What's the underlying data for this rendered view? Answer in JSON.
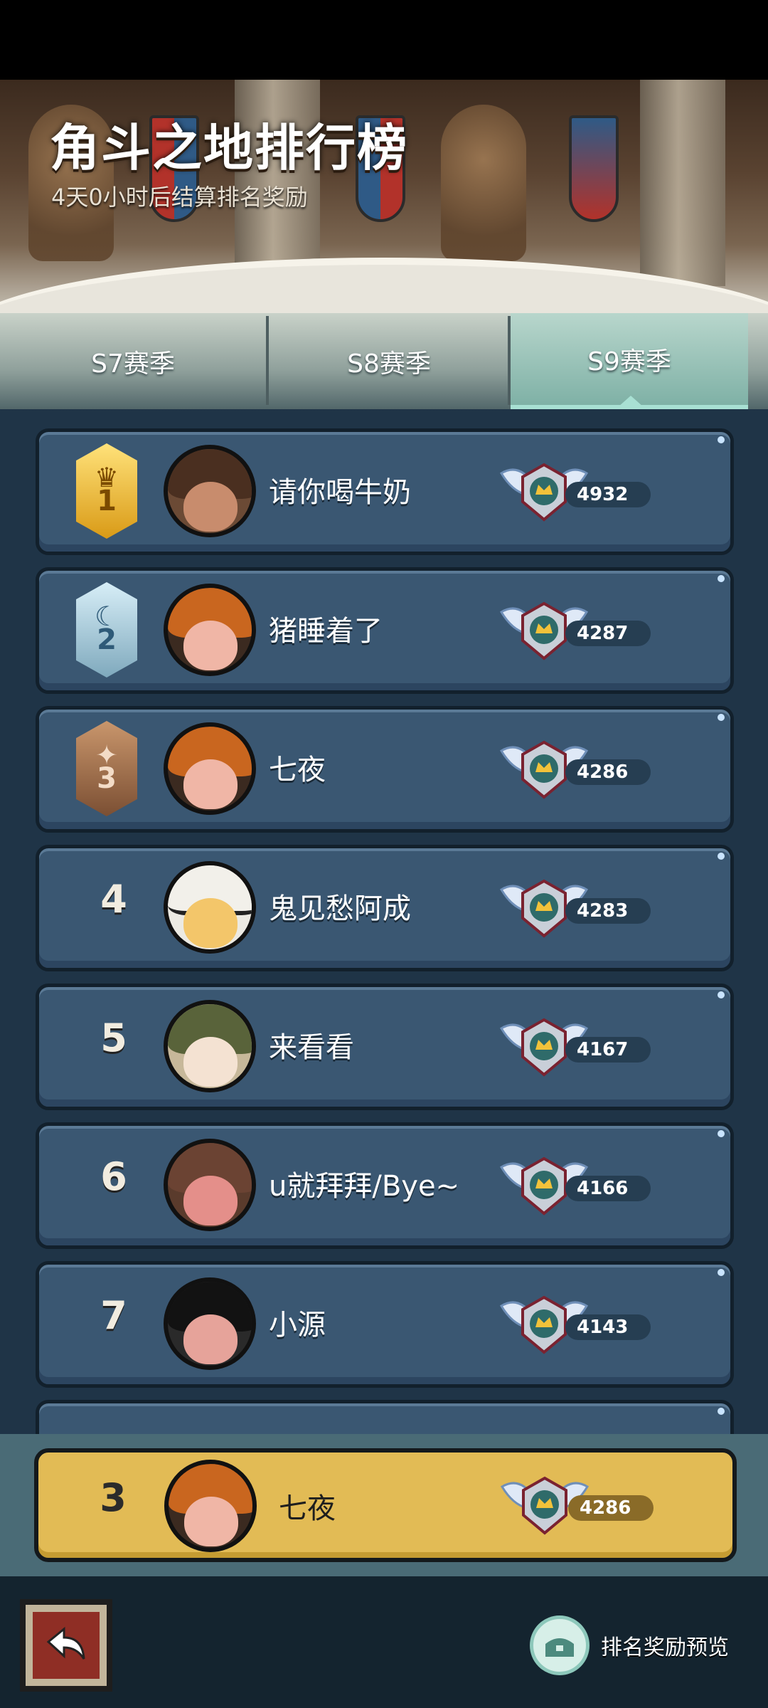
{
  "banner": {
    "title": "角斗之地排行榜",
    "subtitle": "4天0小时后结算排名奖励"
  },
  "tabs": [
    {
      "label": "S7赛季",
      "active": false
    },
    {
      "label": "S8赛季",
      "active": false
    },
    {
      "label": "S9赛季",
      "active": true
    }
  ],
  "leaderboard": [
    {
      "rank": "1",
      "medal": "gold",
      "name": "请你喝牛奶",
      "score": "4932",
      "avatar": "cowboy-hat-avatar"
    },
    {
      "rank": "2",
      "medal": "silver",
      "name": "猪睡着了",
      "score": "4287",
      "avatar": "pumpkin-hat-avatar"
    },
    {
      "rank": "3",
      "medal": "bronze",
      "name": "七夜",
      "score": "4286",
      "avatar": "pumpkin-hat-avatar"
    },
    {
      "rank": "4",
      "medal": "",
      "name": "鬼见愁阿成",
      "score": "4283",
      "avatar": "panda-hood-avatar"
    },
    {
      "rank": "5",
      "medal": "",
      "name": "来看看",
      "score": "4167",
      "avatar": "frog-hat-avatar"
    },
    {
      "rank": "6",
      "medal": "",
      "name": "u就拜拜/Bye~",
      "score": "4166",
      "avatar": "bear-hood-avatar"
    },
    {
      "rank": "7",
      "medal": "",
      "name": "小源",
      "score": "4143",
      "avatar": "masked-avatar"
    }
  ],
  "my_rank": {
    "rank": "3",
    "name": "七夜",
    "score": "4286"
  },
  "bottom": {
    "reward_preview_label": "排名奖励预览"
  },
  "colors": {
    "row_bg": "#3a5772",
    "my_row_bg": "#e2bb55",
    "active_tab": "#a8e0d3"
  }
}
